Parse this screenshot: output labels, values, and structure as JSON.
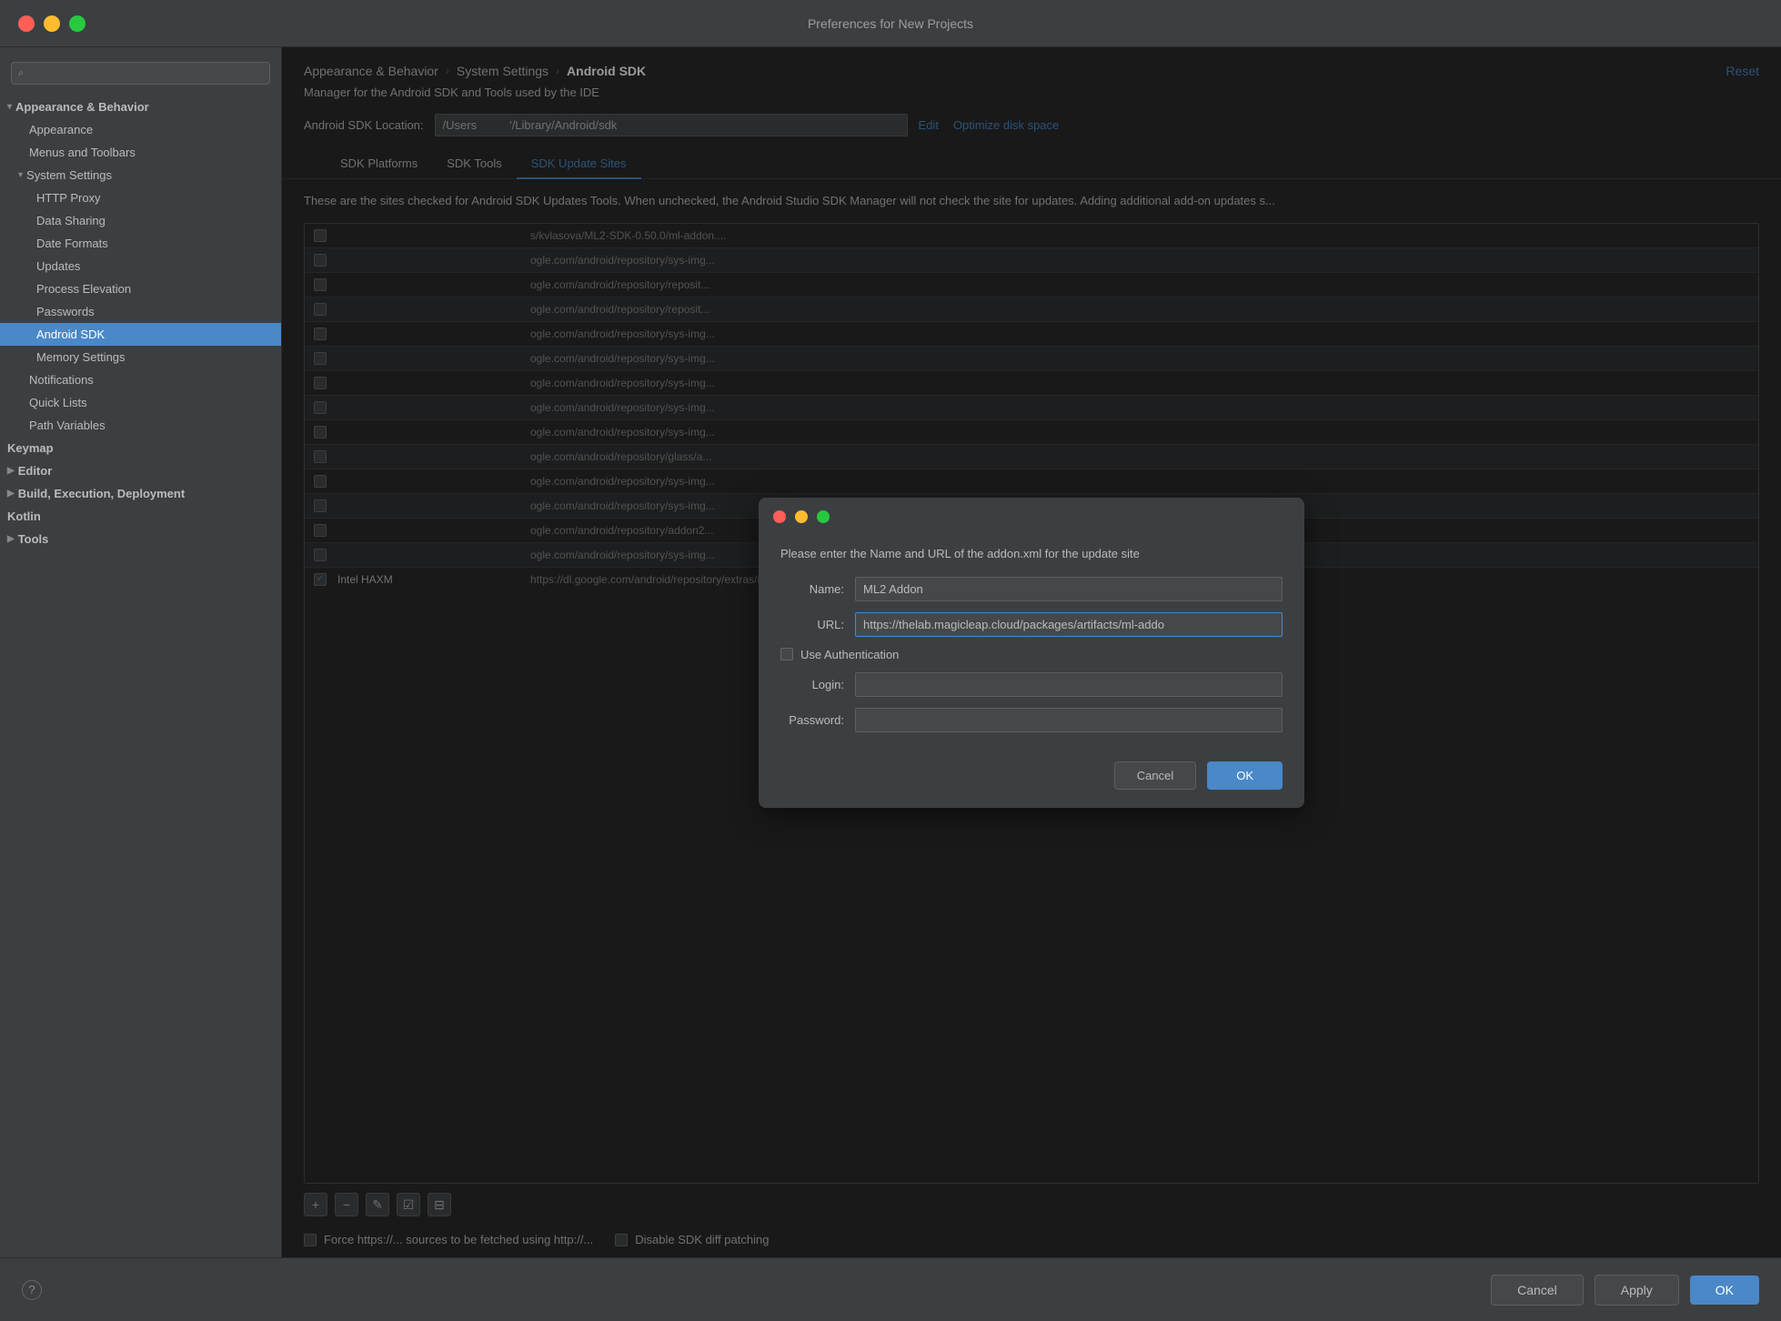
{
  "titleBar": {
    "title": "Preferences for New Projects"
  },
  "sidebar": {
    "searchPlaceholder": "",
    "sections": [
      {
        "id": "appearance-behavior",
        "label": "Appearance & Behavior",
        "expanded": true,
        "level": 0,
        "children": [
          {
            "id": "appearance",
            "label": "Appearance",
            "level": 1
          },
          {
            "id": "menus-toolbars",
            "label": "Menus and Toolbars",
            "level": 1
          },
          {
            "id": "system-settings",
            "label": "System Settings",
            "expanded": true,
            "level": 1,
            "children": [
              {
                "id": "http-proxy",
                "label": "HTTP Proxy",
                "level": 2
              },
              {
                "id": "data-sharing",
                "label": "Data Sharing",
                "level": 2
              },
              {
                "id": "date-formats",
                "label": "Date Formats",
                "level": 2
              },
              {
                "id": "updates",
                "label": "Updates",
                "level": 2
              },
              {
                "id": "process-elevation",
                "label": "Process Elevation",
                "level": 2
              },
              {
                "id": "passwords",
                "label": "Passwords",
                "level": 2
              },
              {
                "id": "android-sdk",
                "label": "Android SDK",
                "level": 2,
                "active": true
              },
              {
                "id": "memory-settings",
                "label": "Memory Settings",
                "level": 2
              }
            ]
          },
          {
            "id": "notifications",
            "label": "Notifications",
            "level": 1
          },
          {
            "id": "quick-lists",
            "label": "Quick Lists",
            "level": 1
          },
          {
            "id": "path-variables",
            "label": "Path Variables",
            "level": 1
          }
        ]
      },
      {
        "id": "keymap",
        "label": "Keymap",
        "level": 0,
        "bold": true
      },
      {
        "id": "editor",
        "label": "Editor",
        "level": 0,
        "bold": true,
        "collapsed": true
      },
      {
        "id": "build-exec",
        "label": "Build, Execution, Deployment",
        "level": 0,
        "bold": true,
        "collapsed": true
      },
      {
        "id": "kotlin",
        "label": "Kotlin",
        "level": 0,
        "bold": true
      },
      {
        "id": "tools",
        "label": "Tools",
        "level": 0,
        "bold": true,
        "collapsed": true
      }
    ]
  },
  "content": {
    "breadcrumb": {
      "items": [
        "Appearance & Behavior",
        "System Settings",
        "Android SDK"
      ]
    },
    "resetLabel": "Reset",
    "managerDesc": "Manager for the Android SDK and Tools used by the IDE",
    "sdkLocationLabel": "Android SDK Location:",
    "sdkLocationValue": "/Users          '/Library/Android/sdk",
    "editLabel": "Edit",
    "optimizeDiskLabel": "Optimize disk space",
    "tabs": [
      {
        "id": "sdk-platforms",
        "label": "SDK Platforms"
      },
      {
        "id": "sdk-tools",
        "label": "SDK Tools"
      },
      {
        "id": "sdk-update-sites",
        "label": "SDK Update Sites",
        "active": true
      }
    ],
    "tabDescription": "These are the sites checked for Android SDK Updates Tools. When unchecked, the Android Studio SDK Manager will not check the site for updates. Adding additional add-on updates s...",
    "tableRows": [
      {
        "checked": false,
        "name": "",
        "url": "s/kvlasova/ML2-SDK-0.50.0/ml-addon...."
      },
      {
        "checked": false,
        "name": "",
        "url": "ogle.com/android/repository/sys-img..."
      },
      {
        "checked": false,
        "name": "",
        "url": "ogle.com/android/repository/reposit..."
      },
      {
        "checked": false,
        "name": "",
        "url": "ogle.com/android/repository/reposit..."
      },
      {
        "checked": false,
        "name": "",
        "url": "ogle.com/android/repository/sys-img..."
      },
      {
        "checked": false,
        "name": "",
        "url": "ogle.com/android/repository/sys-img..."
      },
      {
        "checked": false,
        "name": "",
        "url": "ogle.com/android/repository/sys-img..."
      },
      {
        "checked": false,
        "name": "",
        "url": "ogle.com/android/repository/sys-img..."
      },
      {
        "checked": false,
        "name": "",
        "url": "ogle.com/android/repository/sys-img..."
      },
      {
        "checked": false,
        "name": "",
        "url": "ogle.com/android/repository/glass/a..."
      },
      {
        "checked": false,
        "name": "",
        "url": "ogle.com/android/repository/sys-img..."
      },
      {
        "checked": false,
        "name": "",
        "url": "ogle.com/android/repository/sys-img..."
      },
      {
        "checked": false,
        "name": "",
        "url": "ogle.com/android/repository/addon2..."
      },
      {
        "checked": false,
        "name": "",
        "url": "ogle.com/android/repository/sys-img..."
      },
      {
        "checked": true,
        "name": "Intel HAXM",
        "url": "https://dl.google.com/android/repository/extras/i..."
      }
    ],
    "toolbarButtons": [
      "+",
      "−",
      "✎",
      "☑",
      "⊟"
    ],
    "checkboxes": [
      {
        "id": "force-https",
        "label": "Force https://... sources to be fetched using http://...",
        "checked": false
      },
      {
        "id": "disable-diff",
        "label": "Disable SDK diff patching",
        "checked": false
      }
    ]
  },
  "modal": {
    "titlebarButtons": [
      "close",
      "minimize",
      "maximize"
    ],
    "description": "Please enter the Name and URL of the addon.xml for the update site",
    "nameLabel": "Name:",
    "nameValue": "ML2 Addon",
    "urlLabel": "URL:",
    "urlValue": "https://thelab.magicleap.cloud/packages/artifacts/ml-addo",
    "useAuthLabel": "Use Authentication",
    "loginLabel": "Login:",
    "loginValue": "",
    "passwordLabel": "Password:",
    "passwordValue": "",
    "cancelLabel": "Cancel",
    "okLabel": "OK"
  },
  "footer": {
    "cancelLabel": "Cancel",
    "applyLabel": "Apply",
    "okLabel": "OK"
  }
}
